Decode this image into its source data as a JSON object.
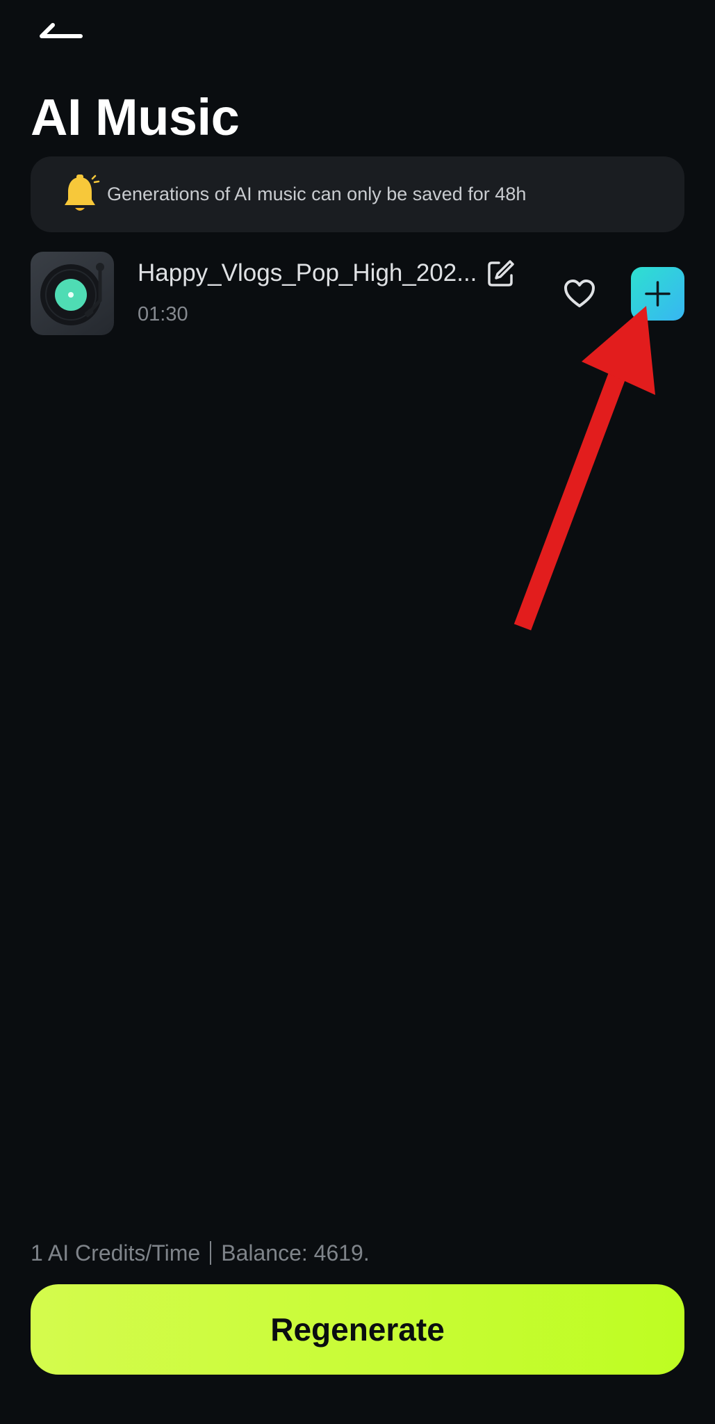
{
  "header": {
    "back_icon": "back-arrow-icon",
    "title": "AI Music"
  },
  "notice": {
    "icon": "bell-icon",
    "text": "Generations of AI music can only be saved for 48h"
  },
  "tracks": [
    {
      "name": "Happy_Vlogs_Pop_High_202...",
      "duration": "01:30",
      "cover_icon": "vinyl-record-icon",
      "edit_icon": "edit-icon",
      "favorite_icon": "heart-icon",
      "add_icon": "plus-icon"
    }
  ],
  "footer": {
    "credits_text": "1 AI Credits/Time",
    "balance_text": "Balance: 4619.",
    "regenerate_label": "Regenerate"
  },
  "colors": {
    "background": "#0a0d10",
    "accent_lime": "#befd22",
    "add_gradient_start": "#2ee0d0",
    "add_gradient_end": "#37b6f2",
    "annotation_arrow": "#e21d1d",
    "bell": "#f7c83a"
  }
}
